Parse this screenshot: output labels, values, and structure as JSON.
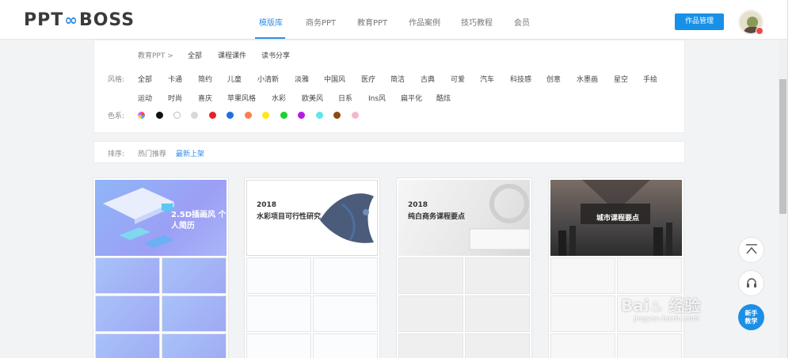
{
  "header": {
    "logo_left": "PPT",
    "logo_mid": "∞",
    "logo_right": "BOSS",
    "nav": [
      "模版库",
      "商务PPT",
      "教育PPT",
      "作品案例",
      "技巧教程",
      "会员"
    ],
    "manage_button": "作品管理",
    "accent_color": "#2f8fe8"
  },
  "breadcrumb": {
    "root": "教育PPT >",
    "items": [
      "全部",
      "课程课件",
      "读书分享"
    ]
  },
  "style_filter": {
    "label": "风格:",
    "row1": [
      "全部",
      "卡通",
      "简约",
      "儿童",
      "小清新",
      "淡雅",
      "中国风",
      "医疗",
      "简洁",
      "古典",
      "可爱",
      "汽车",
      "科技感",
      "创意",
      "水墨画",
      "星空",
      "手绘"
    ],
    "row2": [
      "运动",
      "时尚",
      "喜庆",
      "苹果风格",
      "水彩",
      "欧美风",
      "日系",
      "Ins风",
      "扁平化",
      "酷炫"
    ]
  },
  "color_filter": {
    "label": "色系:",
    "colors": [
      "multicolor",
      "#111111",
      "#ffffff",
      "#d8d8d8",
      "#e8202a",
      "#1f6fe0",
      "#ff7f4a",
      "#ffe61a",
      "#19d12a",
      "#b61ae8",
      "#5fe6ea",
      "#8a4b12",
      "#f6b8c8"
    ]
  },
  "sort": {
    "label": "排序:",
    "options": [
      "热门推荐",
      "最新上架"
    ],
    "active": "最新上架"
  },
  "cards": [
    {
      "title": "2.5D插画风 个人简历",
      "year": ""
    },
    {
      "title": "水彩项目可行性研究",
      "year": "2018"
    },
    {
      "title": "纯白商务课程要点",
      "year": "2018"
    },
    {
      "title": "城市课程要点",
      "year": ""
    }
  ],
  "float": {
    "top_icon": "back-to-top-icon",
    "service_icon": "headset-icon",
    "newbie_line1": "新手",
    "newbie_line2": "教学"
  },
  "watermark": {
    "main": "Bai♨ 经验",
    "sub": "jingyan.baidu.com"
  }
}
